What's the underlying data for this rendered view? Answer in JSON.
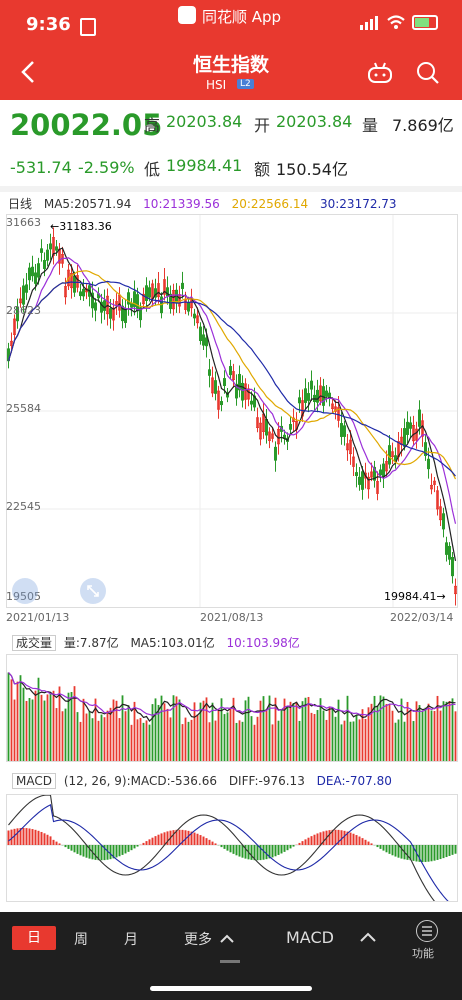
{
  "status_bar": {
    "time": "9:36",
    "center_label": "同花顺 App"
  },
  "header": {
    "title": "恒生指数",
    "code": "HSI",
    "badge": "L2"
  },
  "quote": {
    "price": "20022.05",
    "change": "-531.74",
    "change_pct": "-2.59%",
    "high_label": "高",
    "high": "20203.84",
    "open_label": "开",
    "open": "20203.84",
    "volume_label": "量",
    "volume": "7.869亿",
    "low_label": "低",
    "low": "19984.41",
    "amount_label": "额",
    "amount": "150.54亿"
  },
  "kline": {
    "period_label": "日线",
    "ma5": "MA5:20571.94",
    "ma10": "10:21339.56",
    "ma20": "20:22566.14",
    "ma30": "30:23172.73",
    "y_ticks": [
      "31663",
      "28623",
      "25584",
      "22545",
      "19505"
    ],
    "max_marker": "←31183.36",
    "min_marker": "19984.41→",
    "dates": [
      "2021/01/13",
      "2021/08/13",
      "2022/03/14"
    ],
    "colors": {
      "up": "#e8392f",
      "down": "#2a9a2a",
      "ma5": "#222222",
      "ma10": "#9b30d9",
      "ma20": "#e0a800",
      "ma30": "#1f2aa8"
    }
  },
  "volume": {
    "selector": "成交量",
    "value": "量:7.87亿",
    "ma5": "MA5:103.01亿",
    "ma10": "10:103.98亿"
  },
  "macd": {
    "selector": "MACD",
    "params": "(12, 26, 9):MACD:-536.66",
    "diff": "DIFF:-976.13",
    "dea": "DEA:-707.80"
  },
  "bottom_bar": {
    "tabs": [
      "日",
      "周",
      "月"
    ],
    "more": "更多",
    "indicator": "MACD",
    "function_label": "功能"
  }
}
